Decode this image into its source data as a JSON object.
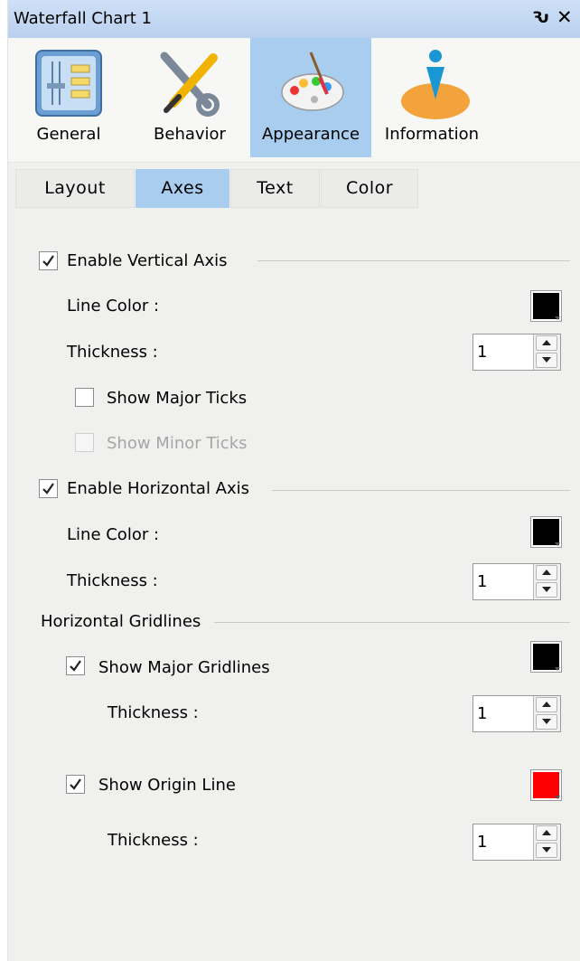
{
  "window": {
    "title": "Waterfall Chart 1",
    "pin_glyph": "Ԅ",
    "close_glyph": "✕"
  },
  "main_tabs": [
    {
      "label": "General",
      "icon": "general-settings-icon",
      "active": false
    },
    {
      "label": "Behavior",
      "icon": "tools-icon",
      "active": false
    },
    {
      "label": "Appearance",
      "icon": "paint-palette-icon",
      "active": true
    },
    {
      "label": "Information",
      "icon": "information-icon",
      "active": false
    }
  ],
  "sub_tabs": [
    {
      "label": "Layout",
      "active": false
    },
    {
      "label": "Axes",
      "active": true
    },
    {
      "label": "Text",
      "active": false
    },
    {
      "label": "Color",
      "active": false
    }
  ],
  "vertical_axis": {
    "enable_label": "Enable Vertical Axis",
    "enabled": true,
    "line_color_label": "Line Color :",
    "line_color": "#000000",
    "thickness_label": "Thickness :",
    "thickness": "1",
    "major_ticks_label": "Show Major Ticks",
    "major_ticks": false,
    "minor_ticks_label": "Show Minor Ticks",
    "minor_ticks": false
  },
  "horizontal_axis": {
    "enable_label": "Enable Horizontal Axis",
    "enabled": true,
    "line_color_label": "Line Color :",
    "line_color": "#000000",
    "thickness_label": "Thickness :",
    "thickness": "1"
  },
  "gridlines": {
    "section_label": "Horizontal Gridlines",
    "major_label": "Show Major Gridlines",
    "major": true,
    "major_color": "#000000",
    "major_thickness_label": "Thickness :",
    "major_thickness": "1",
    "origin_label": "Show Origin Line",
    "origin": true,
    "origin_color": "#ff0000",
    "origin_thickness_label": "Thickness :",
    "origin_thickness": "1"
  }
}
